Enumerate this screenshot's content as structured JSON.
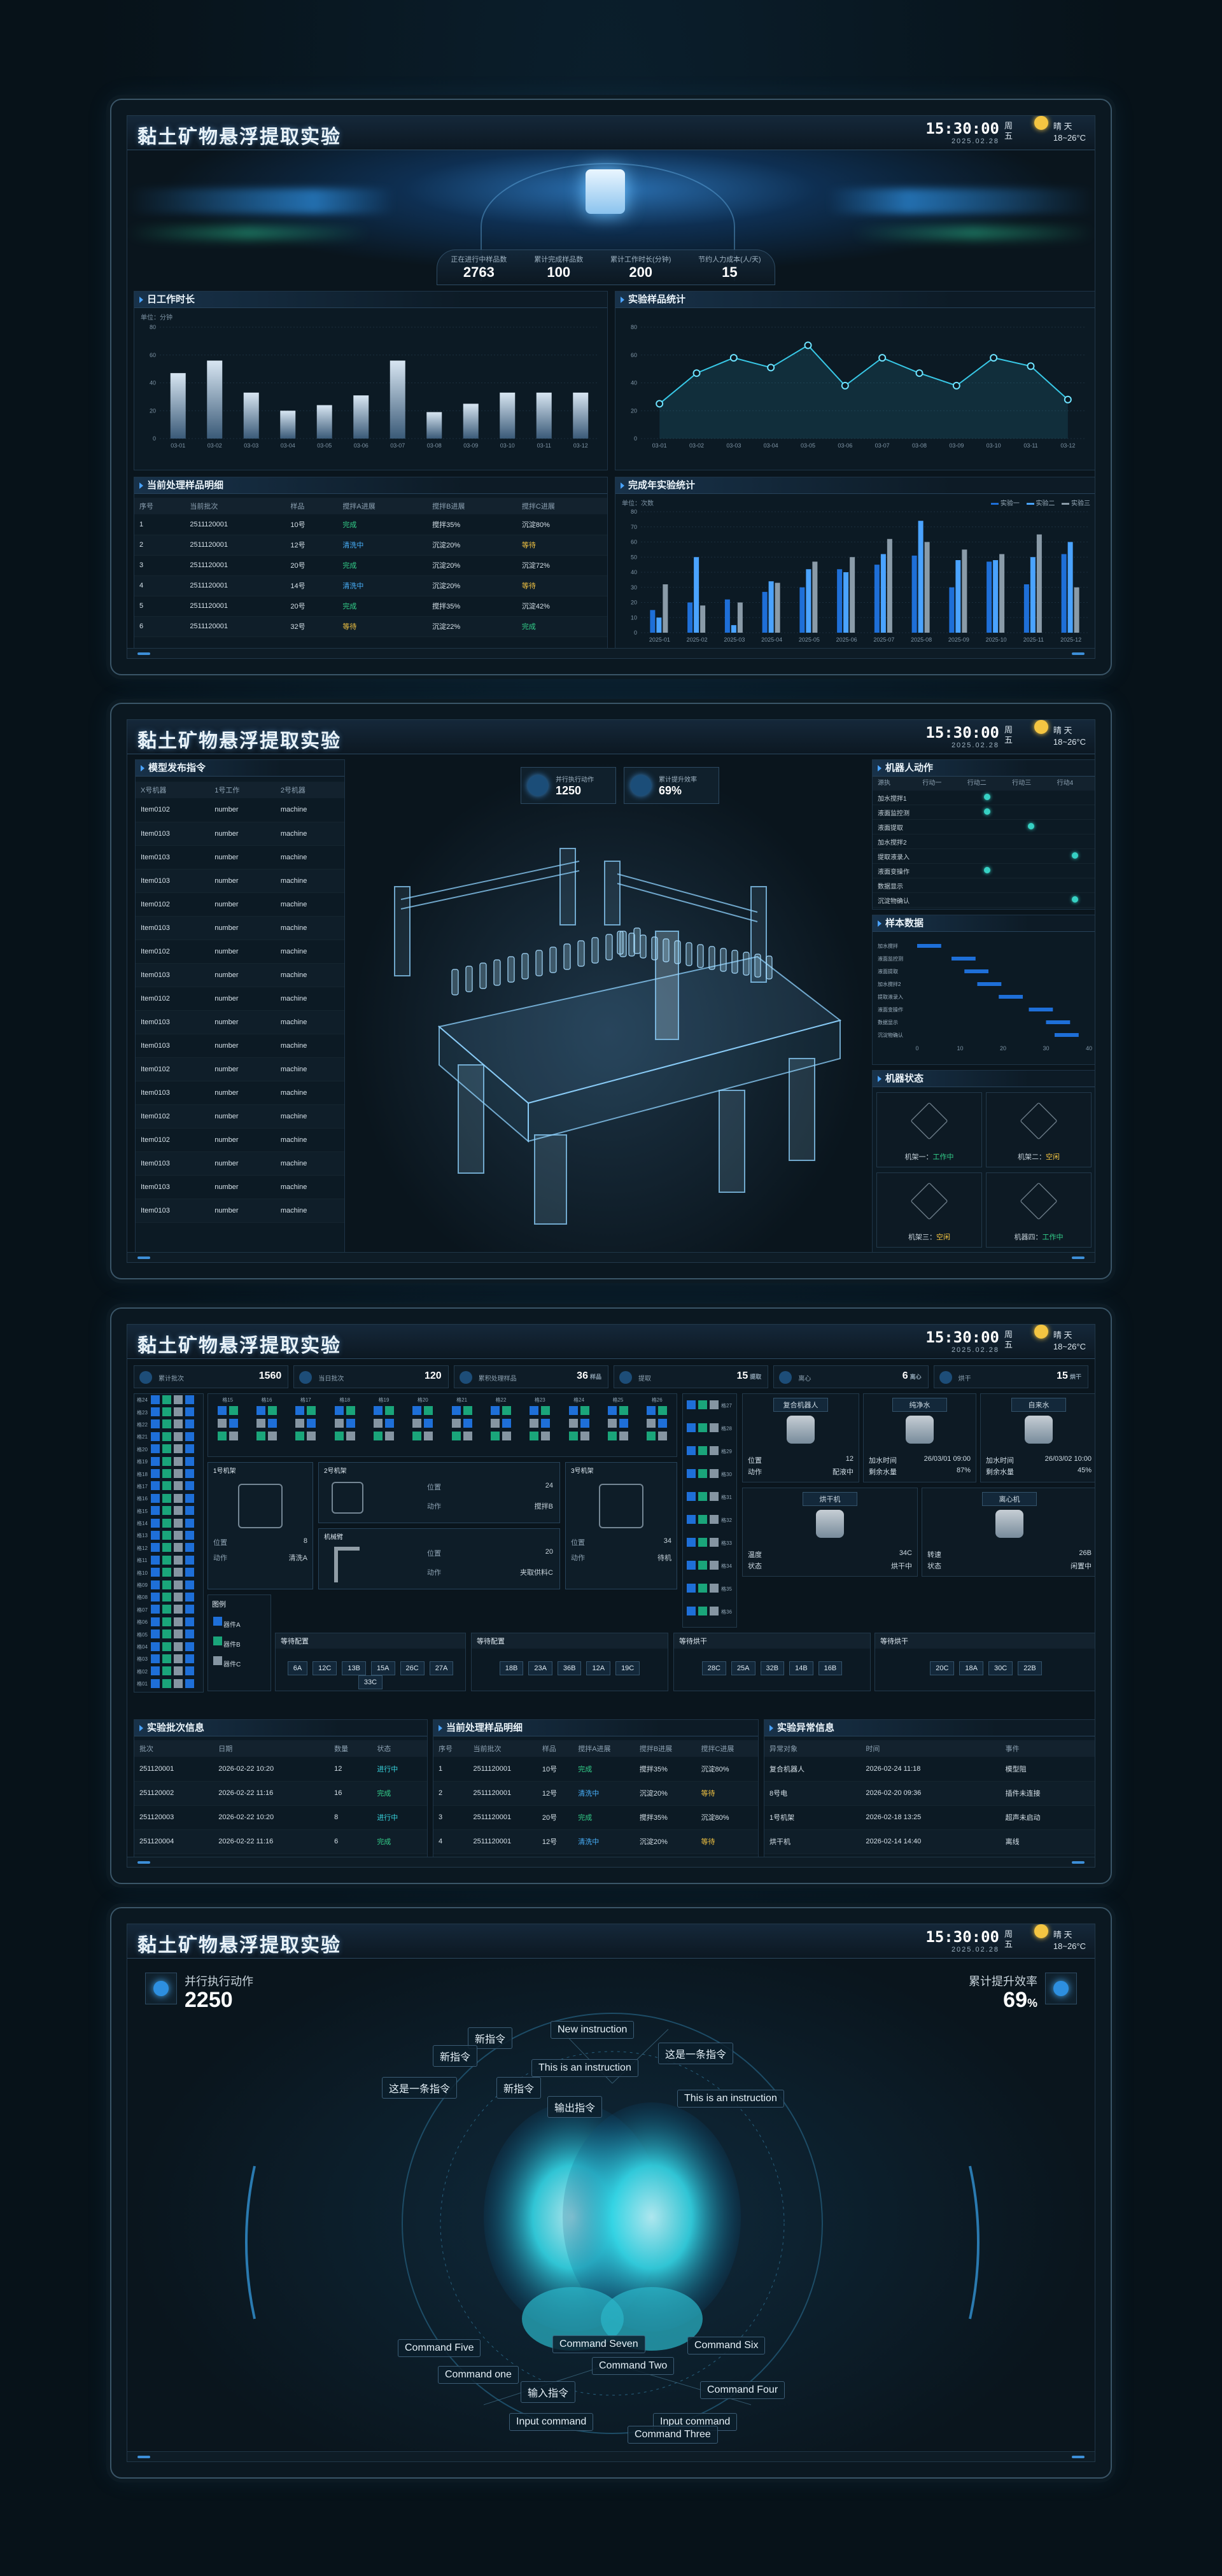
{
  "app_title": "黏土矿物悬浮提取实验",
  "time": "15:30:00",
  "date": "2025.02.28",
  "weekday": "周五",
  "weather": {
    "cond": "晴 天",
    "temp": "18~26°C"
  },
  "s1": {
    "top_stats": [
      {
        "label": "正在进行中样品数",
        "value": "2763"
      },
      {
        "label": "累计完成样品数",
        "value": "100"
      },
      {
        "label": "累计工作时长(分钟)",
        "value": "200"
      },
      {
        "label": "节约人力成本(人/天)",
        "value": "15"
      }
    ],
    "panel_work": "日工作时长",
    "panel_samples": "实验样品统计",
    "panel_detail": "当前处理样品明细",
    "panel_yearly": "完成年实验统计",
    "unit": "单位：分钟",
    "unit2": "单位：次数",
    "detail_headers": [
      "序号",
      "当前批次",
      "样品",
      "搅拌A进展",
      "搅拌B进展",
      "搅拌C进展"
    ],
    "detail_rows": [
      [
        "1",
        "2511120001",
        "10号",
        "完成",
        "搅拌35%",
        "沉淀80%"
      ],
      [
        "2",
        "2511120001",
        "12号",
        "清洗中",
        "沉淀20%",
        "等待"
      ],
      [
        "3",
        "2511120001",
        "20号",
        "完成",
        "沉淀20%",
        "沉淀72%"
      ],
      [
        "4",
        "2511120001",
        "14号",
        "清洗中",
        "沉淀20%",
        "等待"
      ],
      [
        "5",
        "2511120001",
        "20号",
        "完成",
        "搅拌35%",
        "沉淀42%"
      ],
      [
        "6",
        "2511120001",
        "32号",
        "等待",
        "沉淀22%",
        "完成"
      ]
    ],
    "legend": [
      "实验一",
      "实验二",
      "实验三"
    ]
  },
  "chart_data": [
    {
      "type": "bar",
      "title": "日工作时长",
      "ylabel": "单位：分钟",
      "categories": [
        "03-01",
        "03-02",
        "03-03",
        "03-04",
        "03-05",
        "03-06",
        "03-07",
        "03-08",
        "03-09",
        "03-10",
        "03-11",
        "03-12"
      ],
      "values": [
        47,
        56,
        33,
        20,
        24,
        31,
        56,
        19,
        25,
        33,
        33,
        33
      ],
      "ylim": [
        0,
        80
      ],
      "yticks": [
        0,
        20,
        40,
        60,
        80
      ]
    },
    {
      "type": "line",
      "title": "实验样品统计",
      "categories": [
        "03-01",
        "03-02",
        "03-03",
        "03-04",
        "03-05",
        "03-06",
        "03-07",
        "03-08",
        "03-09",
        "03-10",
        "03-11",
        "03-12"
      ],
      "values": [
        25,
        47,
        58,
        51,
        67,
        38,
        58,
        47,
        38,
        58,
        52,
        28
      ],
      "ylim": [
        0,
        80
      ],
      "yticks": [
        0,
        20,
        40,
        60,
        80
      ]
    },
    {
      "type": "bar",
      "title": "完成年实验统计",
      "ylabel": "单位：次数",
      "categories": [
        "2025-01",
        "2025-02",
        "2025-03",
        "2025-04",
        "2025-05",
        "2025-06",
        "2025-07",
        "2025-08",
        "2025-09",
        "2025-10",
        "2025-11",
        "2025-12"
      ],
      "series": [
        {
          "name": "实验一",
          "values": [
            15,
            20,
            22,
            27,
            30,
            42,
            45,
            51,
            30,
            47,
            32,
            52
          ]
        },
        {
          "name": "实验二",
          "values": [
            10,
            50,
            5,
            34,
            42,
            40,
            52,
            74,
            48,
            48,
            50,
            60
          ]
        },
        {
          "name": "实验三",
          "values": [
            32,
            18,
            20,
            33,
            47,
            50,
            62,
            60,
            55,
            52,
            65,
            30
          ]
        }
      ],
      "ylim": [
        0,
        80
      ],
      "yticks": [
        0,
        10,
        20,
        30,
        40,
        50,
        60,
        70,
        80
      ]
    }
  ],
  "s2": {
    "left_title": "模型发布指令",
    "left_headers": [
      "X号机器",
      "1号工作",
      "2号机器"
    ],
    "left_rows": [
      [
        "Item0102",
        "number",
        "machine"
      ],
      [
        "Item0103",
        "number",
        "machine"
      ],
      [
        "Item0103",
        "number",
        "machine"
      ],
      [
        "Item0103",
        "number",
        "machine"
      ],
      [
        "Item0102",
        "number",
        "machine"
      ],
      [
        "Item0103",
        "number",
        "machine"
      ],
      [
        "Item0102",
        "number",
        "machine"
      ],
      [
        "Item0103",
        "number",
        "machine"
      ],
      [
        "Item0102",
        "number",
        "machine"
      ],
      [
        "Item0103",
        "number",
        "machine"
      ],
      [
        "Item0103",
        "number",
        "machine"
      ],
      [
        "Item0102",
        "number",
        "machine"
      ],
      [
        "Item0103",
        "number",
        "machine"
      ],
      [
        "Item0102",
        "number",
        "machine"
      ],
      [
        "Item0102",
        "number",
        "machine"
      ],
      [
        "Item0103",
        "number",
        "machine"
      ],
      [
        "Item0103",
        "number",
        "machine"
      ],
      [
        "Item0103",
        "number",
        "machine"
      ]
    ],
    "stat_a": {
      "label": "并行执行动作",
      "value": "1250"
    },
    "stat_b": {
      "label": "累计提升效率",
      "value": "69%"
    },
    "robot_action_title": "机器人动作",
    "robot_headers": [
      "源执",
      "行动一",
      "行动二",
      "行动三",
      "行动4"
    ],
    "robot_rows": [
      "加水搅拌1",
      "液面监控测",
      "液面提取",
      "加水搅拌2",
      "提取液录入",
      "液面变操作",
      "数据显示",
      "沉淀物确认"
    ],
    "sample_title": "样本数据",
    "sample_rows": [
      {
        "label": "加水搅拌",
        "v": 6
      },
      {
        "label": "液面监控测",
        "v": 14
      },
      {
        "label": "液面提取",
        "v": 17
      },
      {
        "label": "加水搅拌2",
        "v": 20
      },
      {
        "label": "提取液录入",
        "v": 25
      },
      {
        "label": "液面变操作",
        "v": 32
      },
      {
        "label": "数据显示",
        "v": 36
      },
      {
        "label": "沉淀物确认",
        "v": 38
      }
    ],
    "sample_axis": [
      "0",
      "10",
      "20",
      "30",
      "40"
    ],
    "machine_title": "机器状态",
    "machines": [
      {
        "name": "机架一：",
        "state": "工作中",
        "color": "#33d18b"
      },
      {
        "name": "机架二：",
        "state": "空闲",
        "color": "#f4c542"
      },
      {
        "name": "机架三：",
        "state": "空闲",
        "color": "#f4c542"
      },
      {
        "name": "机器四：",
        "state": "工作中",
        "color": "#33d18b"
      }
    ]
  },
  "s3": {
    "top": [
      {
        "label": "累计批次",
        "value": "1560"
      },
      {
        "label": "当日批次",
        "value": "120"
      },
      {
        "label": "累积处理样品",
        "value": "36",
        "unit": "样品"
      },
      {
        "label": "提取",
        "value": "15",
        "unit": "提取"
      },
      {
        "label": "离心",
        "value": "6",
        "unit": "离心"
      },
      {
        "label": "烘干",
        "value": "15",
        "unit": "烘干"
      }
    ],
    "row_labels": [
      "格24",
      "格23",
      "格22",
      "格21",
      "格20",
      "格19",
      "格18",
      "格17",
      "格16",
      "格15",
      "格14",
      "格13",
      "格12",
      "格11",
      "格10",
      "格09",
      "格08",
      "格07",
      "格06",
      "格05",
      "格04",
      "格03",
      "格02",
      "格01"
    ],
    "top_cols": [
      "格15",
      "格16",
      "格17",
      "格18",
      "格19",
      "格20",
      "格21",
      "格22",
      "格23",
      "格24",
      "格25",
      "格26"
    ],
    "right_labels": [
      "格27",
      "格28",
      "格29",
      "格30",
      "格31",
      "格32",
      "格33",
      "格34",
      "格35",
      "格36"
    ],
    "shelf1": {
      "title": "1号机架",
      "pos": "位置",
      "pos_v": "8",
      "act": "动作",
      "act_v": "清洗A"
    },
    "shelf2": {
      "title": "2号机架",
      "pos": "位置",
      "pos_v": "24",
      "act": "动作",
      "act_v": "搅拌B"
    },
    "shelf3": {
      "title": "3号机架",
      "pos": "位置",
      "pos_v": "34",
      "act": "动作",
      "act_v": "待机"
    },
    "arm": {
      "title": "机械臂",
      "pos": "位置",
      "pos_v": "20",
      "act": "动作",
      "act_v": "夹取供料C"
    },
    "devices": [
      {
        "name": "复合机器人",
        "a": "位置",
        "av": "12",
        "b": "动作",
        "bv": "配液中"
      },
      {
        "name": "纯净水",
        "a": "加水时间",
        "av": "26/03/01 09:00",
        "b": "剩余水量",
        "bv": "87%"
      },
      {
        "name": "自来水",
        "a": "加水时间",
        "av": "26/03/02 10:00",
        "b": "剩余水量",
        "bv": "45%"
      },
      {
        "name": "烘干机",
        "a": "温度",
        "av": "34C",
        "b": "状态",
        "bv": "烘干中"
      },
      {
        "name": "离心机",
        "a": "转速",
        "av": "26B",
        "b": "状态",
        "bv": "闲置中"
      }
    ],
    "legend": {
      "title": "图例",
      "items": [
        "器件A",
        "器件B",
        "器件C"
      ]
    },
    "queues": [
      {
        "title": "等待配置",
        "items": [
          "6A",
          "12C",
          "13B",
          "15A",
          "26C",
          "27A",
          "33C"
        ]
      },
      {
        "title": "等待配置",
        "items": [
          "18B",
          "23A",
          "36B",
          "12A",
          "19C"
        ]
      },
      {
        "title": "等待烘干",
        "items": [
          "28C",
          "25A",
          "32B",
          "14B",
          "16B"
        ]
      },
      {
        "title": "等待烘干",
        "items": [
          "20C",
          "18A",
          "30C",
          "22B"
        ]
      }
    ],
    "batch_title": "实验批次信息",
    "batch_headers": [
      "批次",
      "日期",
      "数量",
      "状态"
    ],
    "batch_rows": [
      [
        "251120001",
        "2026-02-22 10:20",
        "12",
        "进行中"
      ],
      [
        "251120002",
        "2026-02-22 11:16",
        "16",
        "完成"
      ],
      [
        "251120003",
        "2026-02-22 10:20",
        "8",
        "进行中"
      ],
      [
        "251120004",
        "2026-02-22 11:16",
        "6",
        "完成"
      ]
    ],
    "detail_title": "当前处理样品明细",
    "detail_headers": [
      "序号",
      "当前批次",
      "样品",
      "搅拌A进展",
      "搅拌B进展",
      "搅拌C进展"
    ],
    "detail_rows": [
      [
        "1",
        "2511120001",
        "10号",
        "完成",
        "搅拌35%",
        "沉淀80%"
      ],
      [
        "2",
        "2511120001",
        "12号",
        "清洗中",
        "沉淀20%",
        "等待"
      ],
      [
        "3",
        "2511120001",
        "20号",
        "完成",
        "搅拌35%",
        "沉淀80%"
      ],
      [
        "4",
        "2511120001",
        "12号",
        "清洗中",
        "沉淀20%",
        "等待"
      ]
    ],
    "alert_title": "实验异常信息",
    "alert_headers": [
      "异常对象",
      "时间",
      "事件"
    ],
    "alert_rows": [
      [
        "复合机器人",
        "2026-02-24 11:18",
        "模型阻"
      ],
      [
        "8号电",
        "2026-02-20 09:36",
        "插件未连接"
      ],
      [
        "1号机架",
        "2026-02-18 13:25",
        "超声未启动"
      ],
      [
        "烘干机",
        "2026-02-14 14:40",
        "离线"
      ]
    ]
  },
  "s4": {
    "left": {
      "label": "并行执行动作",
      "value": "2250"
    },
    "right": {
      "label": "累计提升效率",
      "value": "69",
      "unit": "%"
    },
    "labels": [
      "新指令",
      "New instruction",
      "新指令",
      "This is an instruction",
      "这是一条指令",
      "这是一条指令",
      "新指令",
      "This is an instruction",
      "输出指令",
      "Command Five",
      "Command Seven",
      "Command Six",
      "Command one",
      "Command Two",
      "输入指令",
      "Command Four",
      "Input command",
      "Input command",
      "Command Three"
    ]
  }
}
